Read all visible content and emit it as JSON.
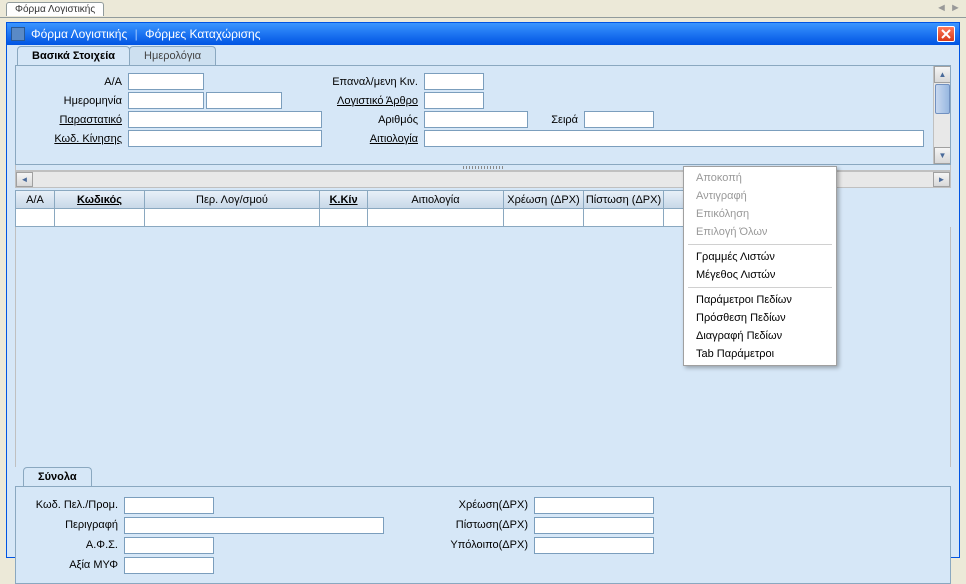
{
  "topTab": "Φόρμα Λογιστικής",
  "window": {
    "title1": "Φόρμα Λογιστικής",
    "sep": "|",
    "title2": "Φόρμες Καταχώρισης"
  },
  "tabs": {
    "basic": "Βασικά Στοιχεία",
    "journal": "Ημερολόγια"
  },
  "form": {
    "aa_label": "Α/Α",
    "date_label": "Ημερομηνία",
    "doc_label": "Παραστατικό",
    "movecode_label": "Κωδ. Κίνησης",
    "repeat_label": "Επαναλ/μενη Κιν.",
    "article_label": "Λογιστικό Άρθρο",
    "number_label": "Αριθμός",
    "series_label": "Σειρά",
    "reason_label": "Αιτιολογία"
  },
  "gridHeaders": [
    "Α/Α",
    "Κωδικός",
    "Περ. Λογ/σμού",
    "Κ.Κίν",
    "Αιτιολογία",
    "Χρέωση (ΔΡΧ)",
    "Πίστωση (ΔΡΧ)"
  ],
  "totalsTab": "Σύνολα",
  "totals": {
    "custcode": "Κωδ. Πελ./Προμ.",
    "descr": "Περιγραφή",
    "afm": "Α.Φ.Σ.",
    "myf": "Αξία  ΜΥΦ",
    "debit": "Χρέωση(ΔΡΧ)",
    "credit": "Πίστωση(ΔΡΧ)",
    "balance": "Υπόλοιπο(ΔΡΧ)"
  },
  "contextMenu": {
    "cut": "Αποκοπή",
    "copy": "Αντιγραφή",
    "paste": "Επικόληση",
    "selectAll": "Επιλογή Όλων",
    "listRows": "Γραμμές Λιστών",
    "listSize": "Μέγεθος Λιστών",
    "fieldParams": "Παράμετροι Πεδίων",
    "addFields": "Πρόσθεση  Πεδίων",
    "delFields": "Διαγραφή Πεδίων",
    "tabParams": "Tab Παράμετροι"
  }
}
